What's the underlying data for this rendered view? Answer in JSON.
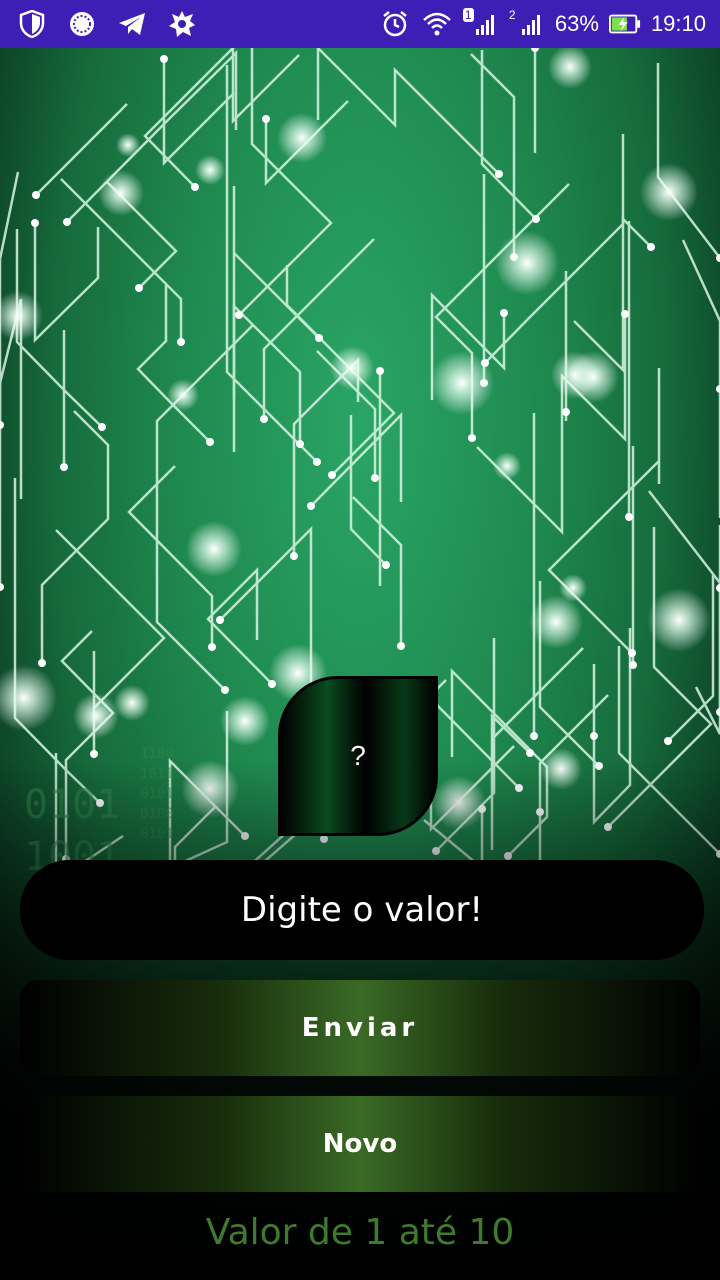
{
  "status_bar": {
    "battery_percent": "63%",
    "time": "19:10",
    "sim1_label": "1",
    "sim2_label": "2"
  },
  "result": {
    "value": "?"
  },
  "input": {
    "placeholder": "Digite o valor!",
    "value": ""
  },
  "buttons": {
    "send_label": "Enviar",
    "new_label": "Novo"
  },
  "range_text": "Valor de 1 até 10",
  "colors": {
    "status_bar": "#3d1fb5",
    "board_green": "#1f8a50",
    "range_text": "#3f7a2e"
  }
}
